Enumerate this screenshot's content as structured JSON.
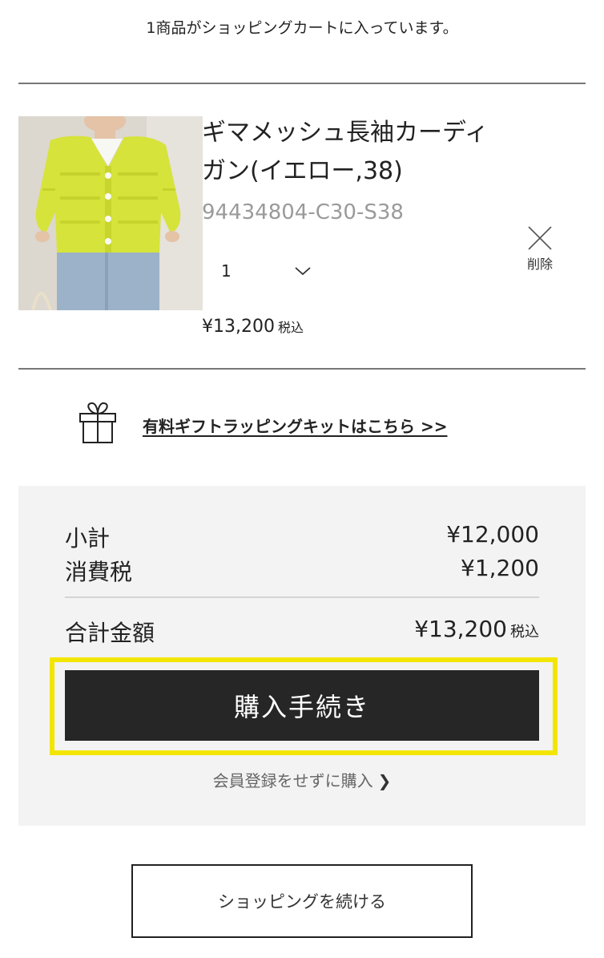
{
  "cart": {
    "count_message": "1商品がショッピングカートに入っています。"
  },
  "item": {
    "name": "ギマメッシュ長袖カーディガン(イエロー,38)",
    "sku": "94434804-C30-S38",
    "quantity": "1",
    "remove_label": "削除",
    "price": "¥13,200",
    "tax_included": "税込",
    "image_icon": "product-photo"
  },
  "gift": {
    "icon": "gift-icon",
    "link_label": "有料ギフトラッピングキットはこちら >>"
  },
  "summary": {
    "subtotal_label": "小計",
    "subtotal_value": "¥12,000",
    "tax_label": "消費税",
    "tax_value": "¥1,200",
    "total_label": "合計金額",
    "total_value": "¥13,200",
    "total_tax_included": "税込"
  },
  "actions": {
    "checkout_label": "購入手続き",
    "guest_checkout_label": "会員登録をせずに購入",
    "guest_chevron": "❯",
    "continue_shopping_label": "ショッピングを続ける"
  },
  "colors": {
    "checkout_button": "#262626",
    "highlight": "#f2e600",
    "summary_background": "#f3f3f3",
    "product_yellow": "#d6e33a"
  }
}
